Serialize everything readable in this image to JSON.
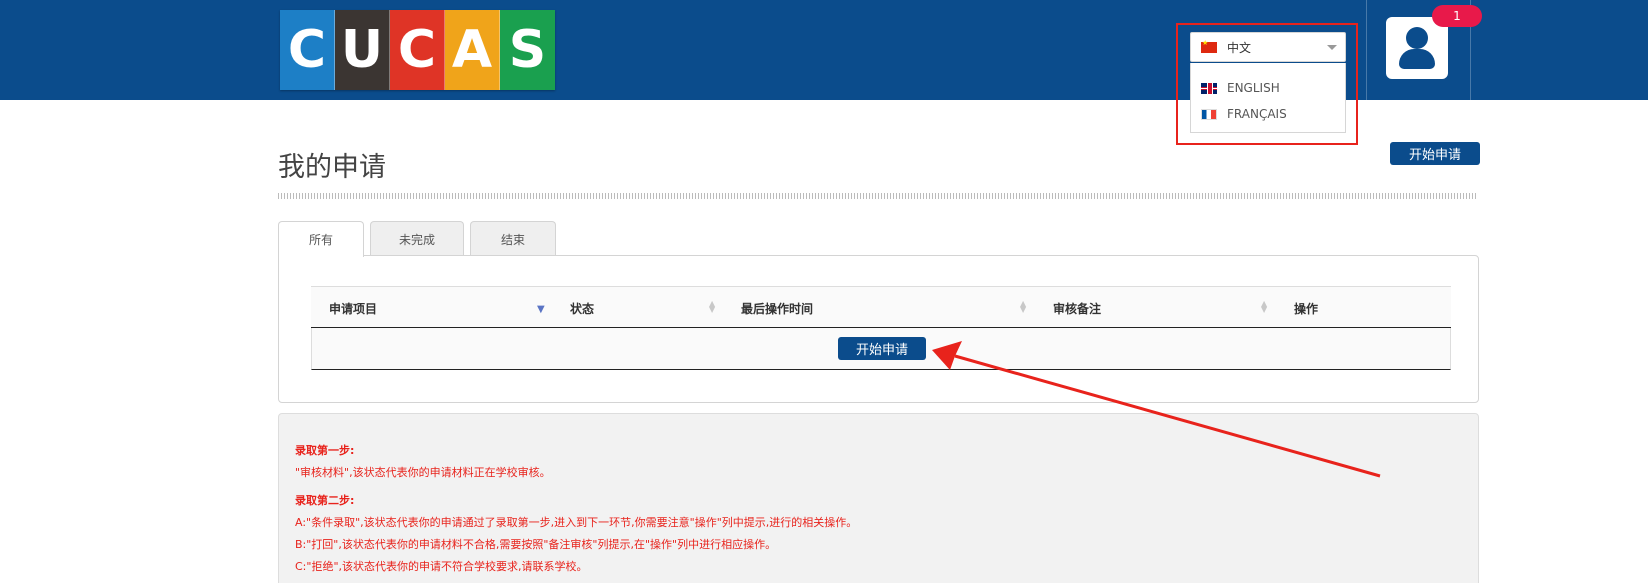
{
  "header": {
    "logo_letters": [
      {
        "char": "C",
        "color": "#1d7fc6"
      },
      {
        "char": "U",
        "color": "#3b3532"
      },
      {
        "char": "C",
        "color": "#df3426"
      },
      {
        "char": "A",
        "color": "#f0a41a"
      },
      {
        "char": "S",
        "color": "#1aa04f"
      }
    ],
    "language": {
      "selected": "中文",
      "options": [
        "ENGLISH",
        "FRANÇAIS"
      ]
    },
    "notification_count": "1"
  },
  "main": {
    "title": "我的申请",
    "start_button": "开始申请",
    "tabs": [
      "所有",
      "未完成",
      "结束"
    ],
    "table": {
      "columns": [
        "申请项目",
        "状态",
        "最后操作时间",
        "审核备注",
        "操作"
      ],
      "empty_action": "开始申请"
    },
    "info": {
      "step1_title": "录取第一步:",
      "step1_text": "\"审核材料\",该状态代表你的申请材料正在学校审核。",
      "step2_title": "录取第二步:",
      "step2_a": "A:\"条件录取\",该状态代表你的申请通过了录取第一步,进入到下一环节,你需要注意\"操作\"列中提示,进行的相关操作。",
      "step2_b": "B:\"打回\",该状态代表你的申请材料不合格,需要按照\"备注审核\"列提示,在\"操作\"列中进行相应操作。",
      "step2_c": "C:\"拒绝\",该状态代表你的申请不符合学校要求,请联系学校。"
    }
  },
  "colors": {
    "brand": "#0b4c8c",
    "annotation": "#e8231c",
    "badge": "#e8194a"
  }
}
